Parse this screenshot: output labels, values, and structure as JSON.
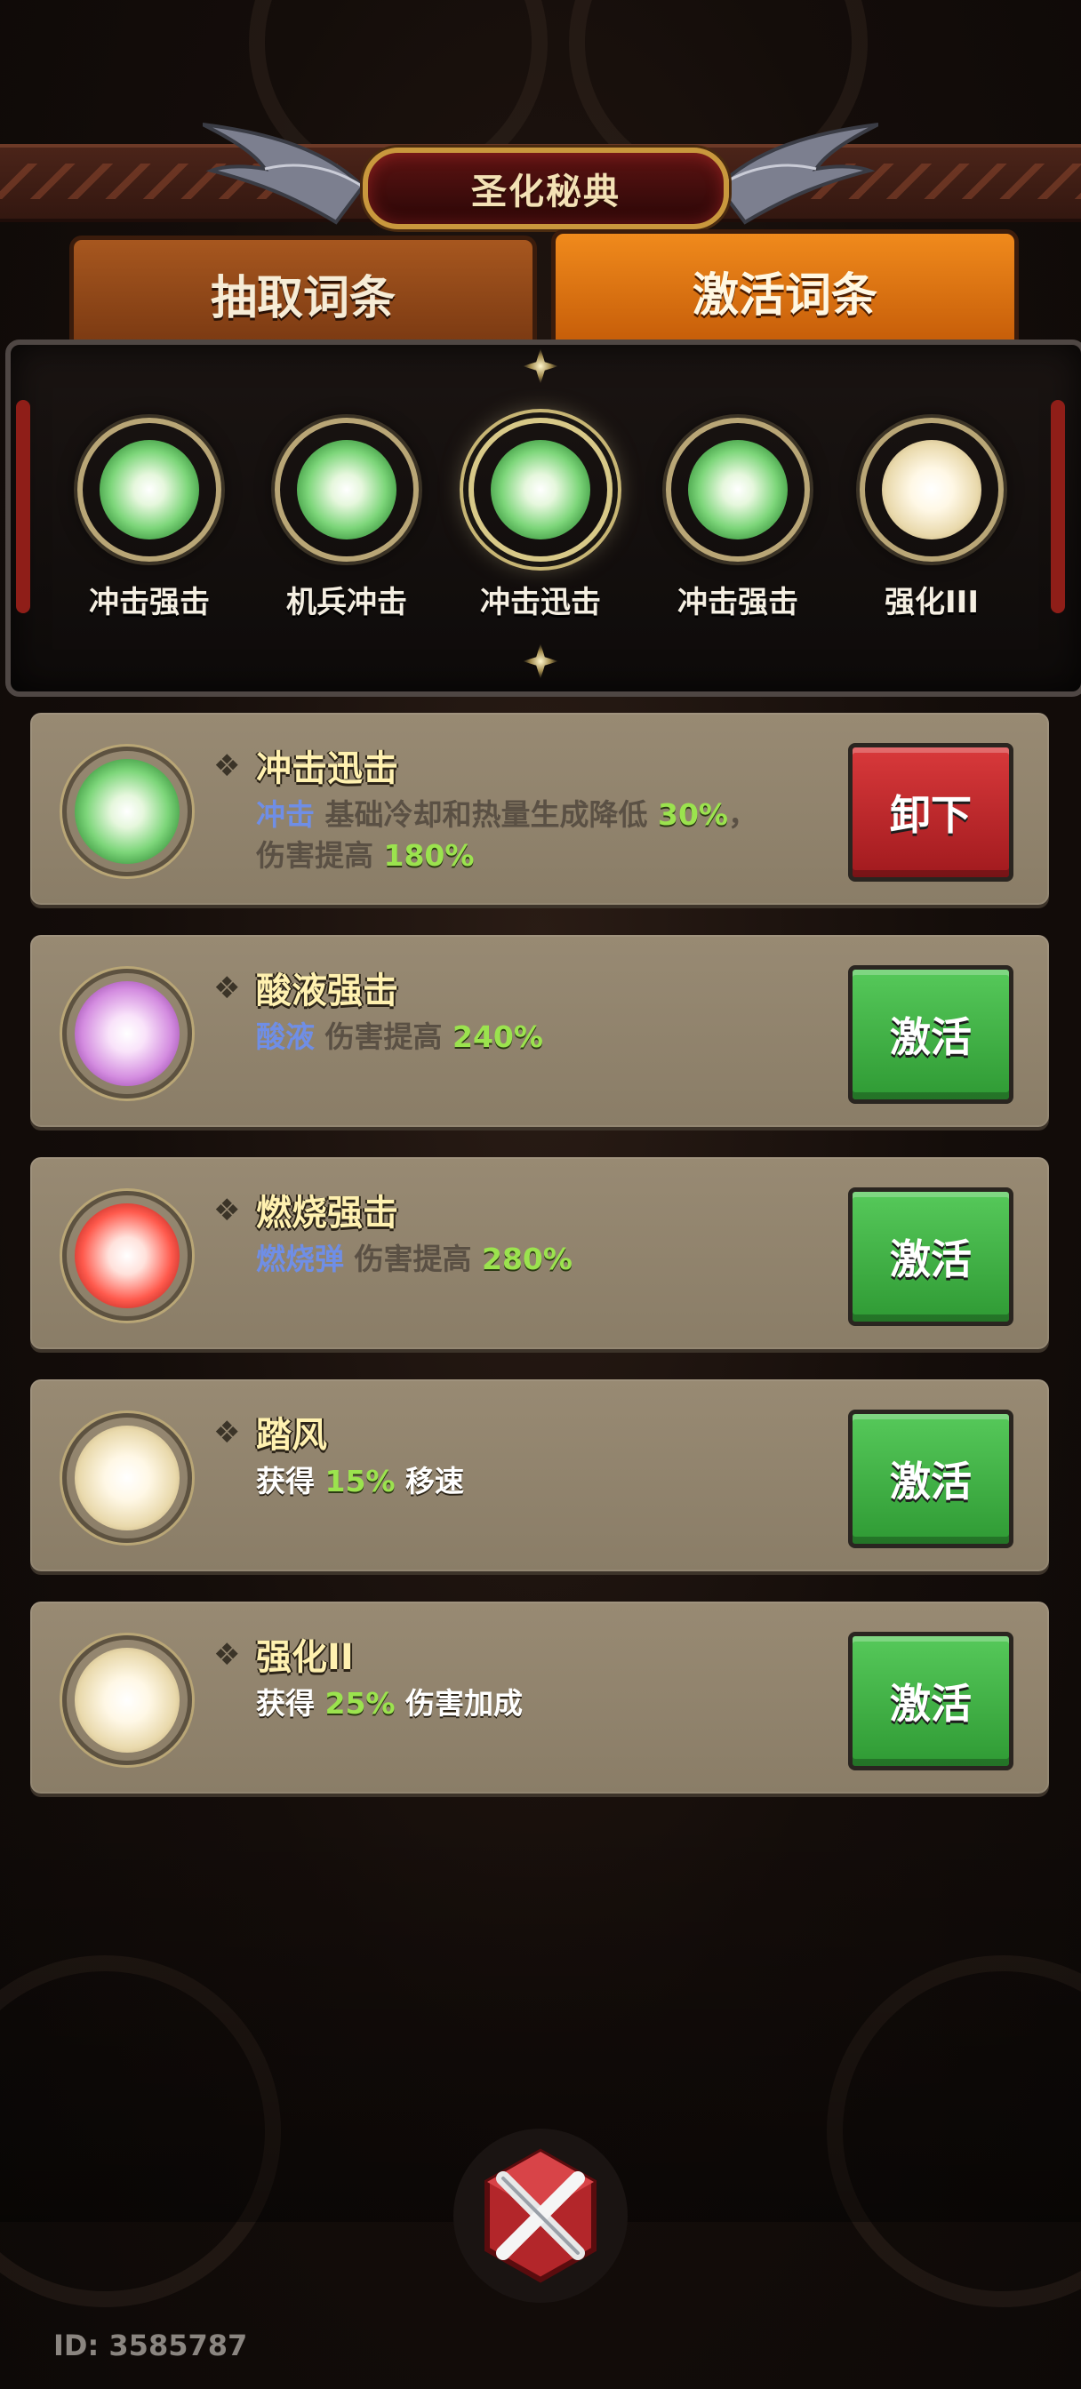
{
  "header": {
    "title": "圣化秘典"
  },
  "tabs": [
    {
      "label": "抽取词条",
      "active": false
    },
    {
      "label": "激活词条",
      "active": true
    }
  ],
  "slots": [
    {
      "label": "冲击强击",
      "orb_color": "green"
    },
    {
      "label": "机兵冲击",
      "orb_color": "green"
    },
    {
      "label": "冲击迅击",
      "orb_color": "green",
      "selected": true
    },
    {
      "label": "冲击强击",
      "orb_color": "green"
    },
    {
      "label": "强化III",
      "orb_color": "white"
    }
  ],
  "cards": [
    {
      "name": "冲击迅击",
      "orb_color": "green",
      "desc_keyword": "冲击",
      "desc_text1": "基础冷却和热量生成降低",
      "desc_pct1": "30%",
      "desc_text2": "，",
      "desc_text3": "伤害提高",
      "desc_pct2": "180%",
      "button": "卸下",
      "button_color": "#c2282b"
    },
    {
      "name": "酸液强击",
      "orb_color": "purple",
      "desc_keyword": "酸液",
      "desc_text1": "伤害提高",
      "desc_pct1": "240%",
      "button": "激活",
      "button_color": "#3fae44"
    },
    {
      "name": "燃烧强击",
      "orb_color": "red",
      "desc_keyword": "燃烧弹",
      "desc_text1": "伤害提高",
      "desc_pct1": "280%",
      "button": "激活",
      "button_color": "#3fae44"
    },
    {
      "name": "踏风",
      "orb_color": "white",
      "desc_text0": "获得",
      "desc_pct1": "15%",
      "desc_text1": "移速",
      "button": "激活",
      "button_color": "#3fae44"
    },
    {
      "name": "强化II",
      "orb_color": "white",
      "desc_text0": "获得",
      "desc_pct1": "25%",
      "desc_text1": "伤害加成",
      "button": "激活",
      "button_color": "#3fae44"
    }
  ],
  "footer": {
    "id_text": "ID: 3585787"
  },
  "icons": {
    "close": "close-x-icon",
    "diamond": "diamond-bullet-icon"
  }
}
